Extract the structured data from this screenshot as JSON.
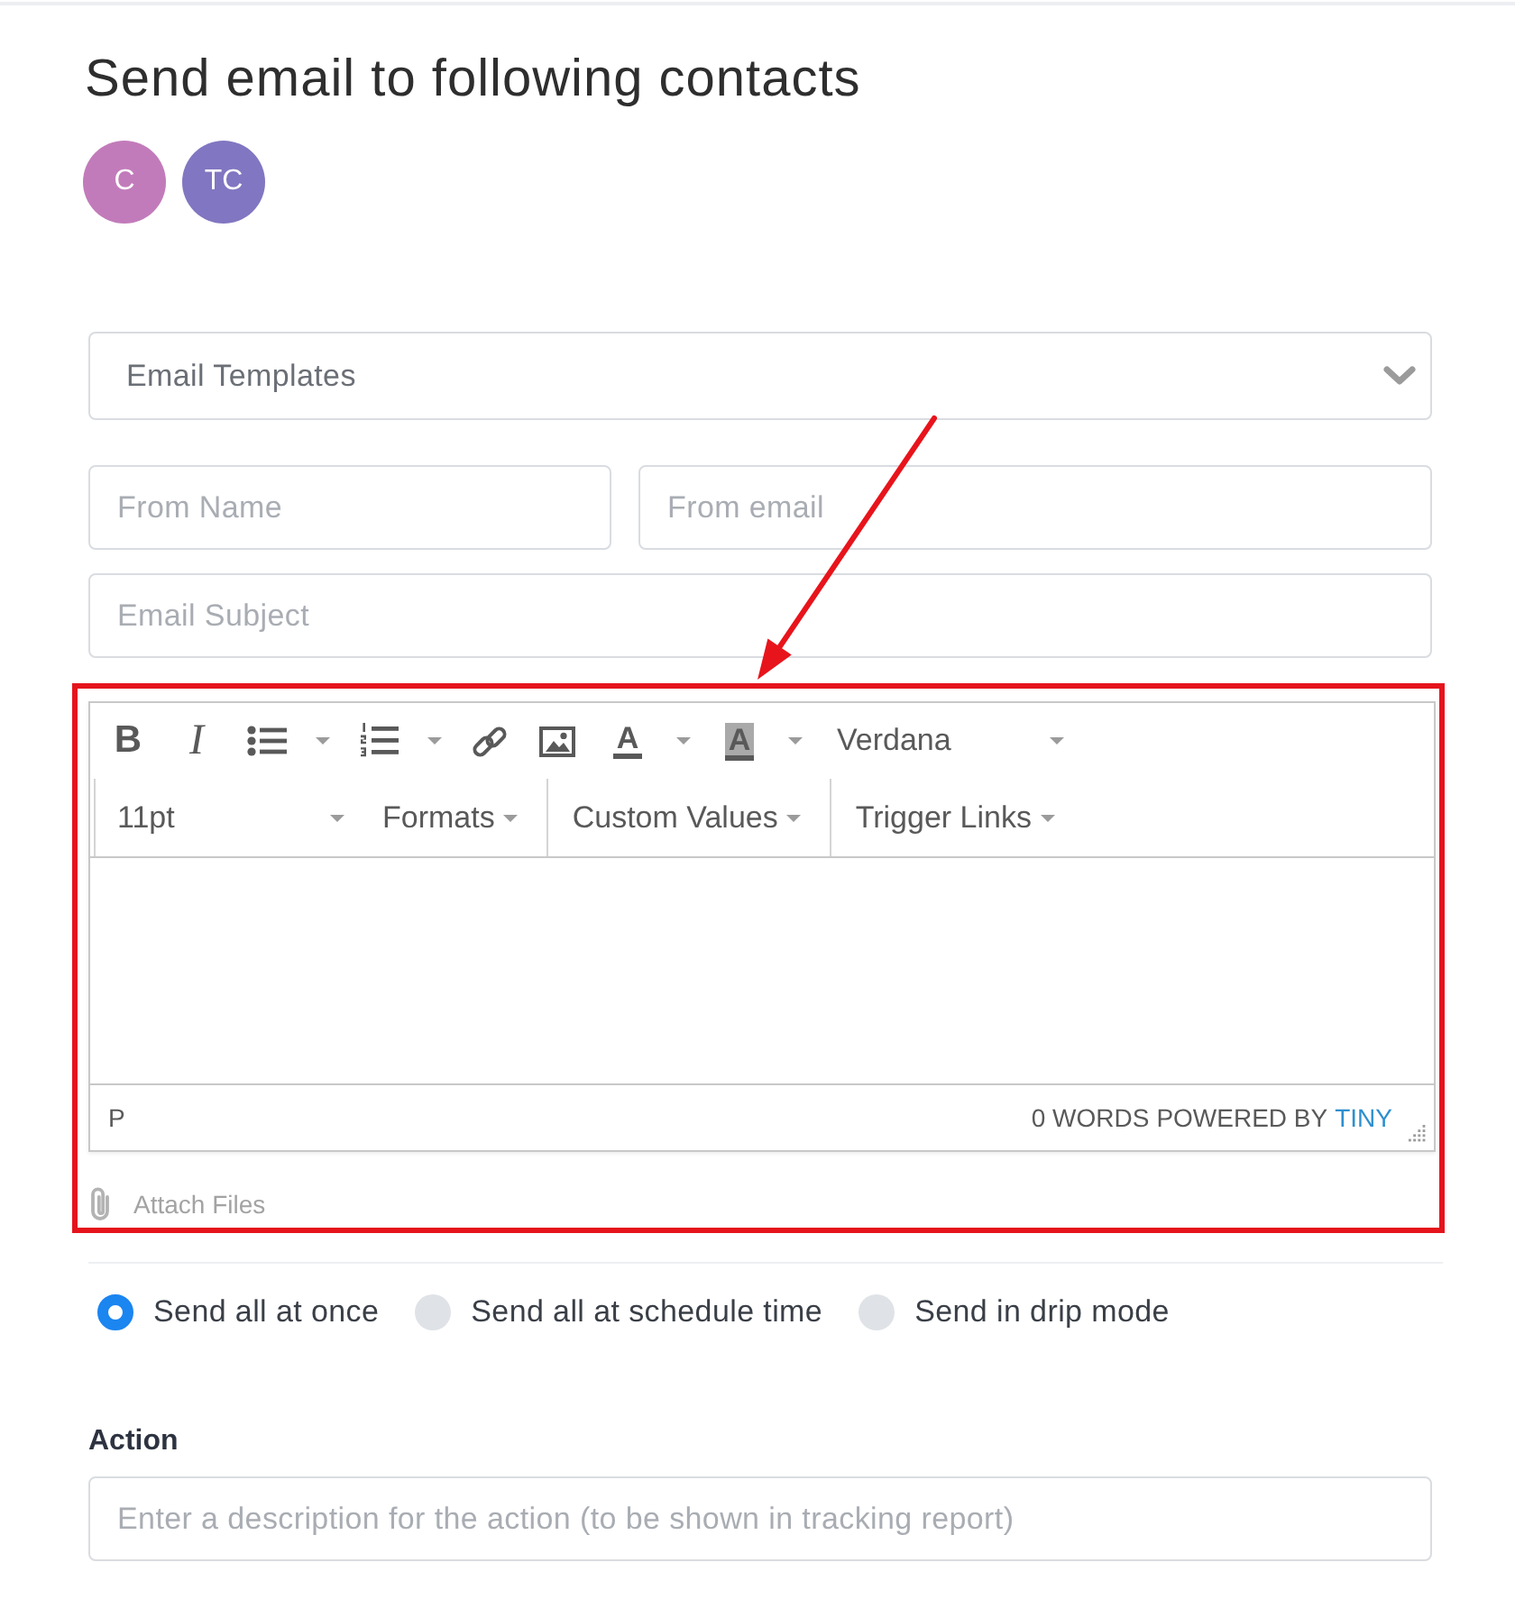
{
  "title": "Send email to following contacts",
  "contacts": [
    {
      "initials": "C",
      "color": "#c27bba"
    },
    {
      "initials": "TC",
      "color": "#8176c1"
    }
  ],
  "template_select": {
    "label": "Email Templates"
  },
  "sender_fields": [
    {
      "placeholder": "From Name"
    },
    {
      "placeholder": "From email"
    }
  ],
  "subject_field": {
    "placeholder": "Email Subject"
  },
  "editor": {
    "toolbar_rows": [
      {
        "groups": [
          {
            "divider": false,
            "items": [
              {
                "kind": "bold",
                "glyph": "B",
                "split": false
              },
              {
                "kind": "italic",
                "glyph": "I",
                "split": false
              },
              {
                "kind": "bullet-list",
                "split": true
              },
              {
                "kind": "numbered-list",
                "split": true
              },
              {
                "kind": "link",
                "split": false
              },
              {
                "kind": "image",
                "split": false
              },
              {
                "kind": "text-color",
                "glyph": "A",
                "split": true
              },
              {
                "kind": "background-color",
                "glyph": "A",
                "split": true
              },
              {
                "kind": "listbox",
                "label": "Verdana"
              }
            ]
          }
        ]
      },
      {
        "groups": [
          {
            "divider": true,
            "items": [
              {
                "kind": "listbox",
                "label": "11pt"
              },
              {
                "kind": "menu",
                "label": "Formats"
              }
            ]
          },
          {
            "divider": true,
            "items": [
              {
                "kind": "menu",
                "label": "Custom Values"
              }
            ]
          },
          {
            "divider": true,
            "items": [
              {
                "kind": "menu",
                "label": "Trigger Links"
              }
            ]
          }
        ]
      }
    ],
    "status_bar": {
      "path": "P",
      "word_count": "0 WORDS",
      "branding": "POWERED BY",
      "brand_link": "TINY"
    }
  },
  "attach": {
    "label": "Attach Files"
  },
  "send_modes": [
    {
      "label": "Send all at once",
      "selected": true
    },
    {
      "label": "Send all at schedule time",
      "selected": false
    },
    {
      "label": "Send in drip mode",
      "selected": false
    }
  ],
  "action": {
    "label": "Action",
    "placeholder": "Enter a description for the action (to be shown in tracking report)"
  },
  "annotations": {
    "highlight_frame": true,
    "pointer_arrow": true
  }
}
